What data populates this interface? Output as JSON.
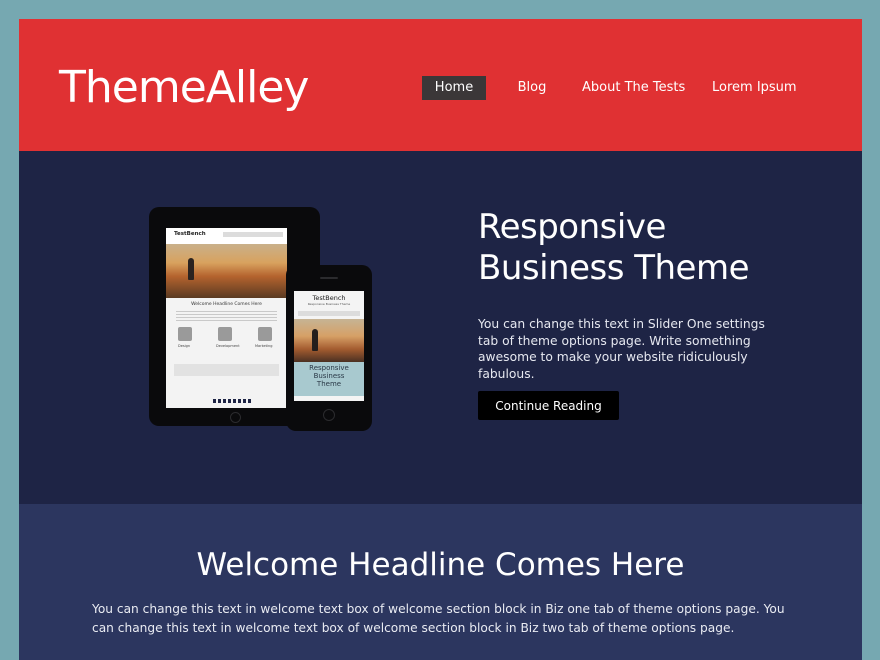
{
  "header": {
    "logo": "ThemeAlley",
    "nav": [
      {
        "label": "Home",
        "active": true
      },
      {
        "label": "Blog",
        "active": false
      },
      {
        "label": "About The Tests",
        "active": false
      },
      {
        "label": "Lorem Ipsum",
        "active": false
      }
    ]
  },
  "hero": {
    "title_line1": "Responsive",
    "title_line2": "Business Theme",
    "text": "You can change this text in Slider One settings tab of theme options page. Write something awesome to make your website ridiculously fabulous.",
    "button_label": "Continue Reading",
    "mockup": {
      "tablet_site_title": "TestBench",
      "tablet_headline": "Welcome Headline Comes Here",
      "tablet_features": [
        "Design",
        "Development",
        "Marketing"
      ],
      "phone_site_title": "TestBench",
      "phone_tagline": "Responsive Business Theme",
      "phone_caption_lines": [
        "Responsive",
        "Business",
        "Theme"
      ]
    }
  },
  "welcome": {
    "title": "Welcome Headline Comes Here",
    "text": "You can change this text in welcome text box of welcome section block in Biz one tab of theme options page. You can change this text in welcome text box of welcome section block in Biz two tab of theme options page."
  },
  "colors": {
    "header_bg": "#e03133",
    "hero_bg": "#1e2445",
    "welcome_bg": "#2c365f",
    "page_border": "#76a8b1",
    "nav_active_bg": "#3b3738"
  }
}
